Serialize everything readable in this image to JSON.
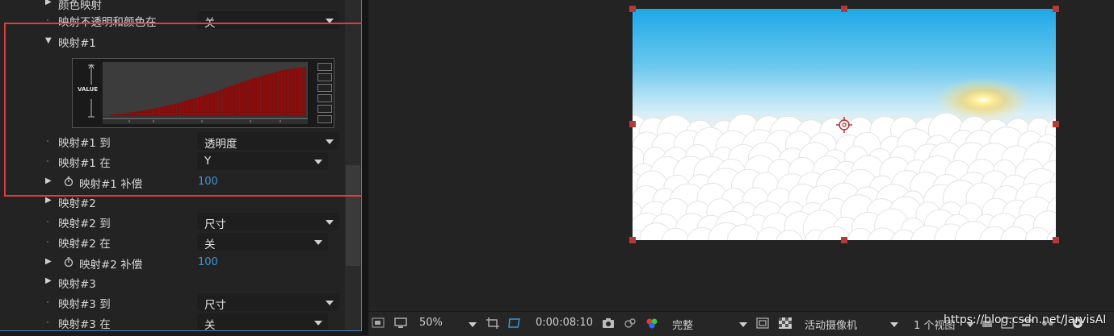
{
  "effect_panel": {
    "header_partial": "颜色映射",
    "rows": [
      {
        "label": "映射不透明和颜色在",
        "value": "关"
      },
      {
        "label": "映射#1"
      },
      {
        "label": "映射#1 到",
        "value": "透明度"
      },
      {
        "label": "映射#1 在",
        "value": "Y"
      },
      {
        "label": "映射#1 补偿",
        "value": "100"
      },
      {
        "label": "映射#2"
      },
      {
        "label": "映射#2 到",
        "value": "尺寸"
      },
      {
        "label": "映射#2 在",
        "value": "关"
      },
      {
        "label": "映射#2 补偿",
        "value": "100"
      },
      {
        "label": "映射#3"
      },
      {
        "label": "映射#3 到",
        "value": "尺寸"
      },
      {
        "label": "映射#3 在",
        "value": "关"
      }
    ],
    "graph": {
      "value_label": "VALUE",
      "curve_levels": [
        0.03,
        0.04,
        0.05,
        0.05,
        0.06,
        0.07,
        0.08,
        0.09,
        0.1,
        0.11,
        0.13,
        0.14,
        0.15,
        0.17,
        0.18,
        0.2,
        0.22,
        0.23,
        0.25,
        0.27,
        0.29,
        0.31,
        0.33,
        0.35,
        0.37,
        0.39,
        0.41,
        0.44,
        0.46,
        0.48,
        0.51,
        0.53,
        0.56,
        0.58,
        0.61,
        0.63,
        0.66,
        0.68,
        0.71,
        0.73,
        0.76,
        0.78,
        0.8,
        0.82,
        0.84,
        0.86,
        0.88,
        0.9,
        0.92,
        0.94,
        0.95,
        0.96,
        0.97,
        0.98,
        0.99,
        1.0
      ]
    }
  },
  "toolbar": {
    "zoom": "50%",
    "timecode": "0:00:08:10",
    "resolution": "完整",
    "camera": "活动摄像机",
    "views": "1 个视图"
  },
  "watermark": "https://blog.csdn.net/JarvisAI",
  "colors": {
    "highlight": "#e33a3a",
    "curve_bar": "#8b0a0a",
    "value_blue": "#3d95d5",
    "sky_top": "#2fb0e8"
  }
}
